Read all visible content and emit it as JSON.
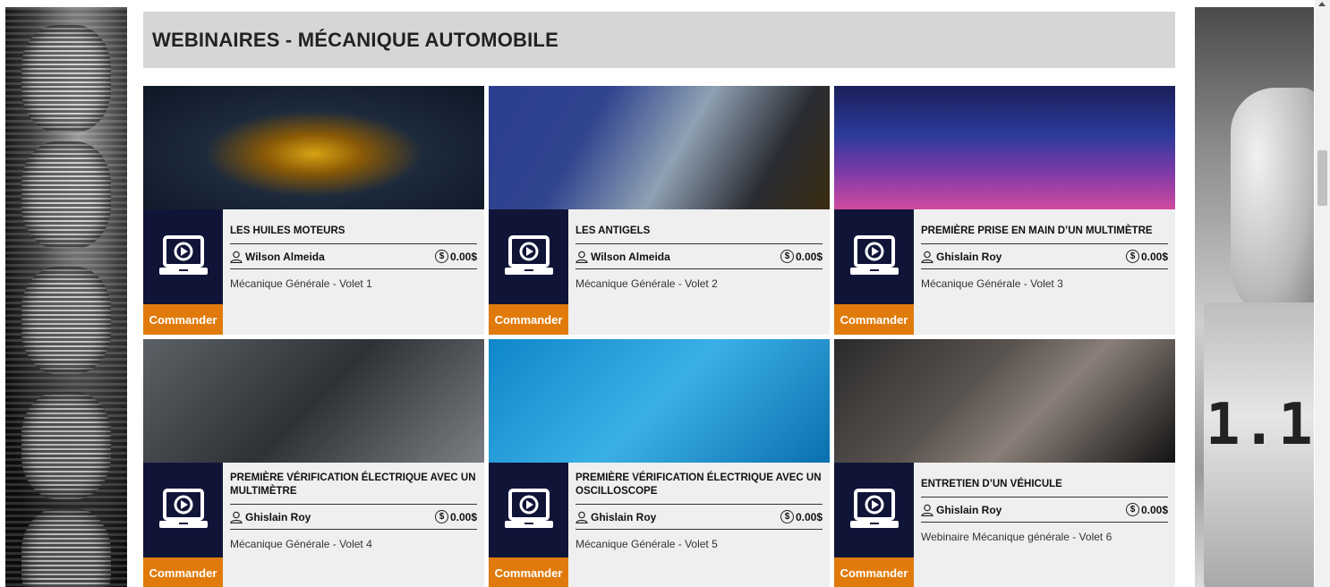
{
  "section": {
    "title": "WEBINAIRES - MÉCANIQUE AUTOMOBILE"
  },
  "order_label": "Commander",
  "colors": {
    "navy": "#101538",
    "accent_orange": "#e07a0b",
    "header_gray": "#d6d6d6",
    "card_bg": "#efefef"
  },
  "cards": [
    {
      "title": "LES HUILES MOTEURS",
      "author": "Wilson Almeida",
      "price": "0.00$",
      "category": "Mécanique Générale - Volet 1",
      "image": "engine-oil-image"
    },
    {
      "title": "LES ANTIGELS",
      "author": "Wilson Almeida",
      "price": "0.00$",
      "category": "Mécanique Générale - Volet 2",
      "image": "antifreeze-image"
    },
    {
      "title": "PREMIÈRE PRISE EN MAIN D’UN MULTIMÈTRE",
      "author": "Ghislain Roy",
      "price": "0.00$",
      "category": "Mécanique Générale - Volet 3",
      "image": "multimeters-image"
    },
    {
      "title": "PREMIÈRE VÉRIFICATION ÉLECTRIQUE AVEC UN MULTIMÈTRE",
      "author": "Ghislain Roy",
      "price": "0.00$",
      "category": "Mécanique Générale - Volet 4",
      "image": "electrical-check-image"
    },
    {
      "title": "PREMIÈRE VÉRIFICATION ÉLECTRIQUE AVEC UN OSCILLOSCOPE",
      "author": "Ghislain Roy",
      "price": "0.00$",
      "category": "Mécanique Générale - Volet 5",
      "image": "oscilloscope-image"
    },
    {
      "title": "ENTRETIEN D’UN VÉHICULE",
      "author": "Ghislain Roy",
      "price": "0.00$",
      "category": "Webinaire Mécanique générale - Volet 6",
      "image": "vehicle-maintenance-image"
    }
  ],
  "decor": {
    "meter_reading": "1.10"
  }
}
